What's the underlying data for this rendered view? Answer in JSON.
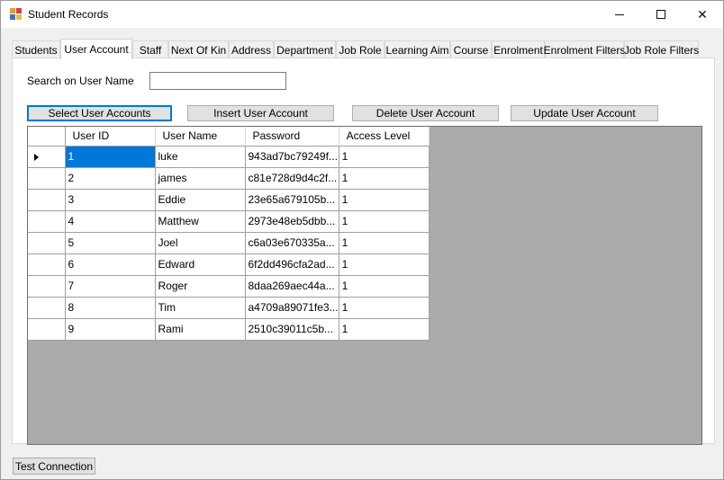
{
  "window": {
    "title": "Student Records",
    "minimize_glyph": "",
    "close_glyph": "✕"
  },
  "tabs": [
    {
      "label": "Students",
      "active": false
    },
    {
      "label": "User Account",
      "active": true
    },
    {
      "label": "Staff",
      "active": false
    },
    {
      "label": "Next Of Kin",
      "active": false
    },
    {
      "label": "Address",
      "active": false
    },
    {
      "label": "Department",
      "active": false
    },
    {
      "label": "Job Role",
      "active": false
    },
    {
      "label": "Learning Aim",
      "active": false
    },
    {
      "label": "Course",
      "active": false
    },
    {
      "label": "Enrolment",
      "active": false
    },
    {
      "label": "Enrolment Filters",
      "active": false
    },
    {
      "label": "Job Role Filters",
      "active": false
    }
  ],
  "search": {
    "label": "Search on User Name",
    "value": ""
  },
  "buttons": {
    "select": "Select User Accounts",
    "insert": "Insert User Account",
    "delete": "Delete User Account",
    "update": "Update User Account",
    "test_connection": "Test Connection"
  },
  "grid": {
    "columns": [
      "User ID",
      "User Name",
      "Password",
      "Access Level"
    ],
    "rows": [
      [
        "1",
        "luke",
        "943ad7bc79249f...",
        "1"
      ],
      [
        "2",
        "james",
        "c81e728d9d4c2f...",
        "1"
      ],
      [
        "3",
        "Eddie",
        "23e65a679105b...",
        "1"
      ],
      [
        "4",
        "Matthew",
        "2973e48eb5dbb...",
        "1"
      ],
      [
        "5",
        "Joel",
        "c6a03e670335a...",
        "1"
      ],
      [
        "6",
        "Edward",
        "6f2dd496cfa2ad...",
        "1"
      ],
      [
        "7",
        "Roger",
        "8daa269aec44a...",
        "1"
      ],
      [
        "8",
        "Tim",
        "a4709a89071fe3...",
        "1"
      ],
      [
        "9",
        "Rami",
        "2510c39011c5b...",
        "1"
      ]
    ]
  },
  "colors": {
    "selection": "#0078d7",
    "grid_background": "#ababab",
    "accent_border": "#0078d7"
  }
}
